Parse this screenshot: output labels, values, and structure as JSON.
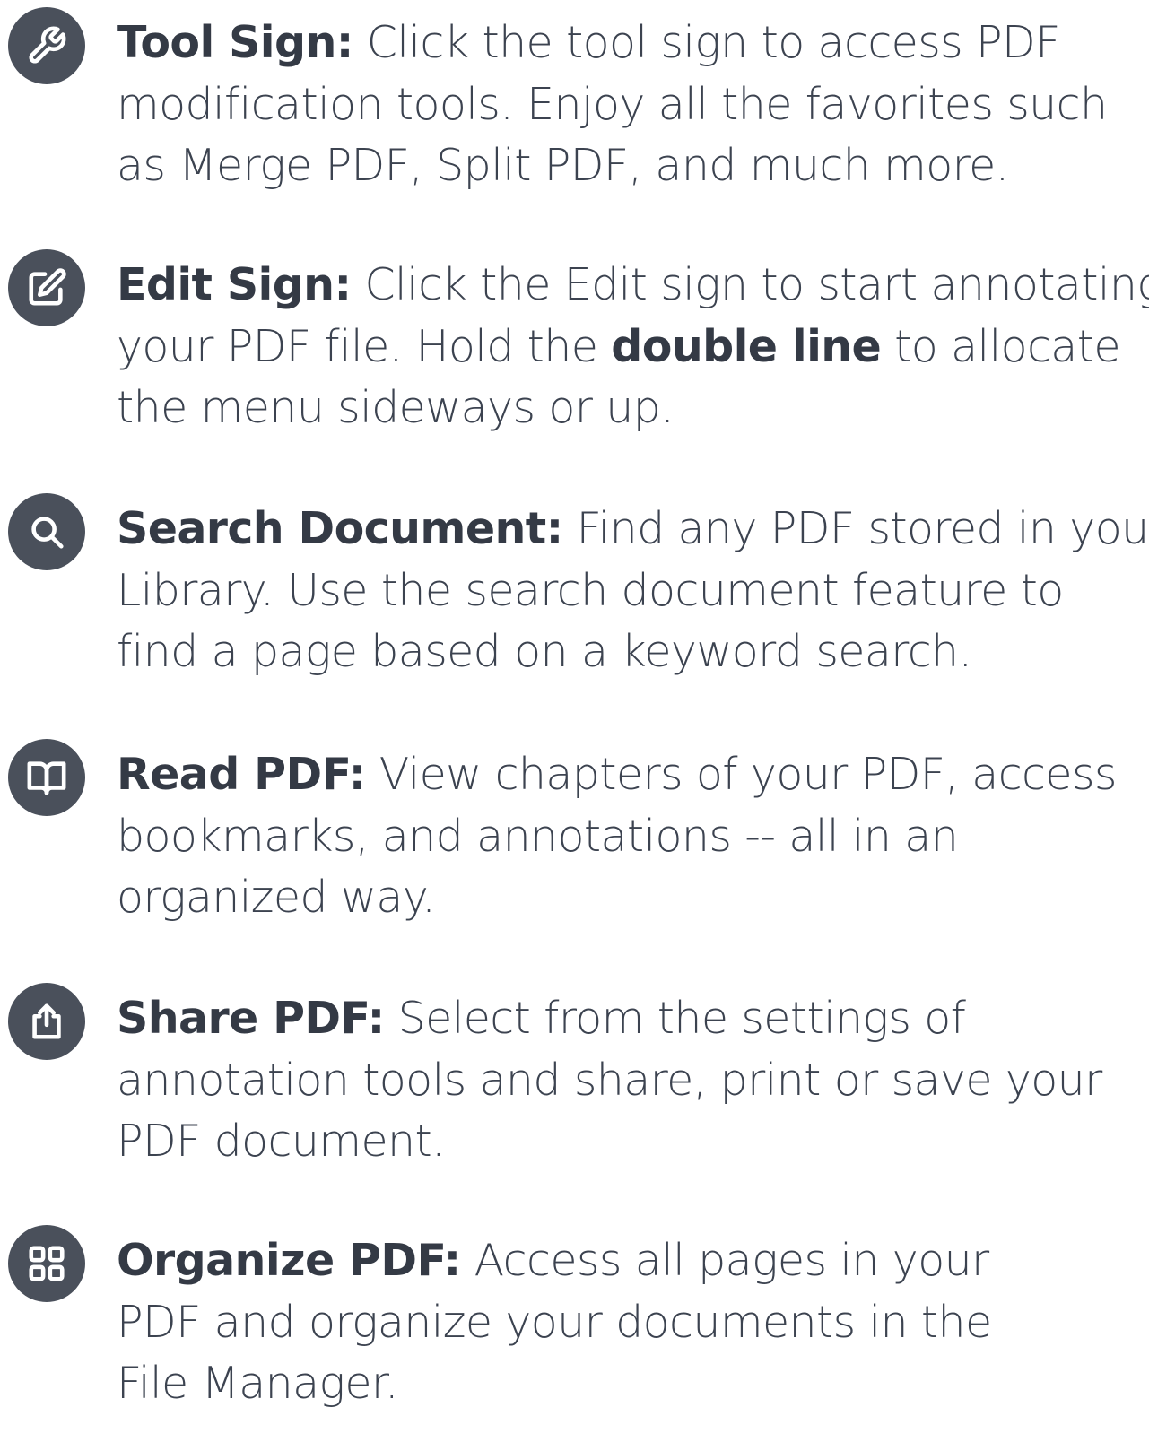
{
  "features": [
    {
      "icon": "wrench-icon",
      "title": "Tool Sign:",
      "lines": [
        " Click the tool sign to access PDF",
        "modification tools. Enjoy all the favorites such",
        "as Merge PDF, Split PDF, and much more."
      ]
    },
    {
      "icon": "edit-icon",
      "title": "Edit Sign:",
      "line1": " Click the Edit sign to start annotating",
      "line2_before": "your PDF file. Hold the ",
      "line2_bold": "double line",
      "line2_after": " to allocate",
      "line3": "the menu sideways or up."
    },
    {
      "icon": "search-icon",
      "title": "Search Document:",
      "lines": [
        " Find any PDF stored in your",
        "Library. Use the search document feature to",
        "find a page based on a keyword search."
      ]
    },
    {
      "icon": "book-icon",
      "title": "Read PDF:",
      "lines": [
        " View chapters of your PDF, access",
        "bookmarks, and annotations --  all in an",
        "organized way."
      ]
    },
    {
      "icon": "share-icon",
      "title": "Share PDF:",
      "lines": [
        " Select from the settings of",
        "annotation tools and share, print or save your",
        "PDF document."
      ]
    },
    {
      "icon": "grid-icon",
      "title": "Organize PDF:",
      "lines": [
        " Access all pages in your",
        "PDF and organize your documents in the",
        "File Manager."
      ]
    }
  ]
}
